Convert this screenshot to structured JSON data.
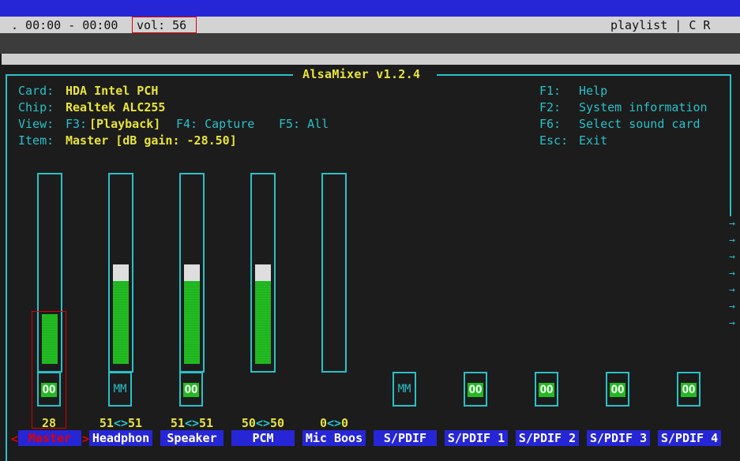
{
  "statusbar": {
    "position": ". 00:00 - 00:00",
    "volume": "vol: 56",
    "right": "playlist | C R"
  },
  "mixer": {
    "title": "AlsaMixer v1.2.4",
    "info": {
      "card_label": "Card:",
      "card_value": "HDA Intel PCH",
      "chip_label": "Chip:",
      "chip_value": "Realtek ALC255",
      "view_label": "View:",
      "view_f3": "F3:",
      "view_playback": "[Playback]",
      "view_f4": "F4: Capture",
      "view_f5": "F5: All",
      "item_label": "Item:",
      "item_value": "Master [dB gain: -28.50]"
    },
    "keys": [
      {
        "key": "F1:",
        "action": "Help"
      },
      {
        "key": "F2:",
        "action": "System information"
      },
      {
        "key": "F6:",
        "action": "Select sound card"
      },
      {
        "key": "Esc:",
        "action": "Exit"
      }
    ],
    "channels": [
      {
        "name": "Master",
        "level": 28,
        "level_text": "28",
        "mute": "OO",
        "selected": true
      },
      {
        "name": "Headphon",
        "level": 51,
        "left": "51",
        "sep": "<>",
        "right": "51",
        "mute": "MM"
      },
      {
        "name": "Speaker",
        "level": 51,
        "left": "51",
        "sep": "<>",
        "right": "51",
        "mute": "OO"
      },
      {
        "name": "PCM",
        "level": 50,
        "left": "50",
        "sep": "<>",
        "right": "50"
      },
      {
        "name": "Mic Boos",
        "level": 0,
        "left": "0",
        "sep": "<>",
        "right": "0"
      },
      {
        "name": "S/PDIF",
        "mute": "MM"
      },
      {
        "name": "S/PDIF 1",
        "mute": "OO"
      },
      {
        "name": "S/PDIF 2",
        "mute": "OO"
      },
      {
        "name": "S/PDIF 3",
        "mute": "OO"
      },
      {
        "name": "S/PDIF 4",
        "mute": "OO"
      }
    ],
    "selector_left": "<",
    "selector_right": ">",
    "scroll_arrow": "→"
  }
}
